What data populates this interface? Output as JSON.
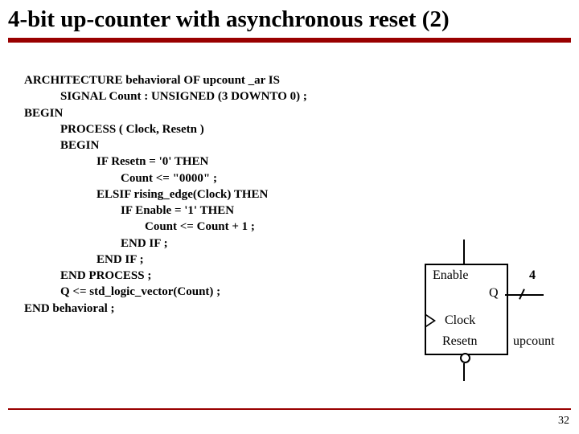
{
  "title": "4-bit up-counter with asynchronous reset (2)",
  "code": {
    "l1": "ARCHITECTURE behavioral OF upcount _ar IS",
    "l2": "            SIGNAL Count : UNSIGNED (3 DOWNTO 0) ;",
    "l3": "BEGIN",
    "l4": "            PROCESS ( Clock, Resetn )",
    "l5": "            BEGIN",
    "l6": "                        IF Resetn = '0' THEN",
    "l7": "                                Count <= \"0000\" ;",
    "l8": "                        ELSIF rising_edge(Clock) THEN",
    "l9": "                                IF Enable = '1' THEN",
    "l10": "                                        Count <= Count + 1 ;",
    "l11": "                                END IF ;",
    "l12": "                        END IF ;",
    "l13": "            END PROCESS ;",
    "l14": "            Q <= std_logic_vector(Count) ;",
    "l15": "END behavioral ;"
  },
  "diagram": {
    "enable": "Enable",
    "q": "Q",
    "clock": "Clock",
    "resetn": "Resetn",
    "buswidth": "4",
    "name": "upcount"
  },
  "pagenum": "32"
}
